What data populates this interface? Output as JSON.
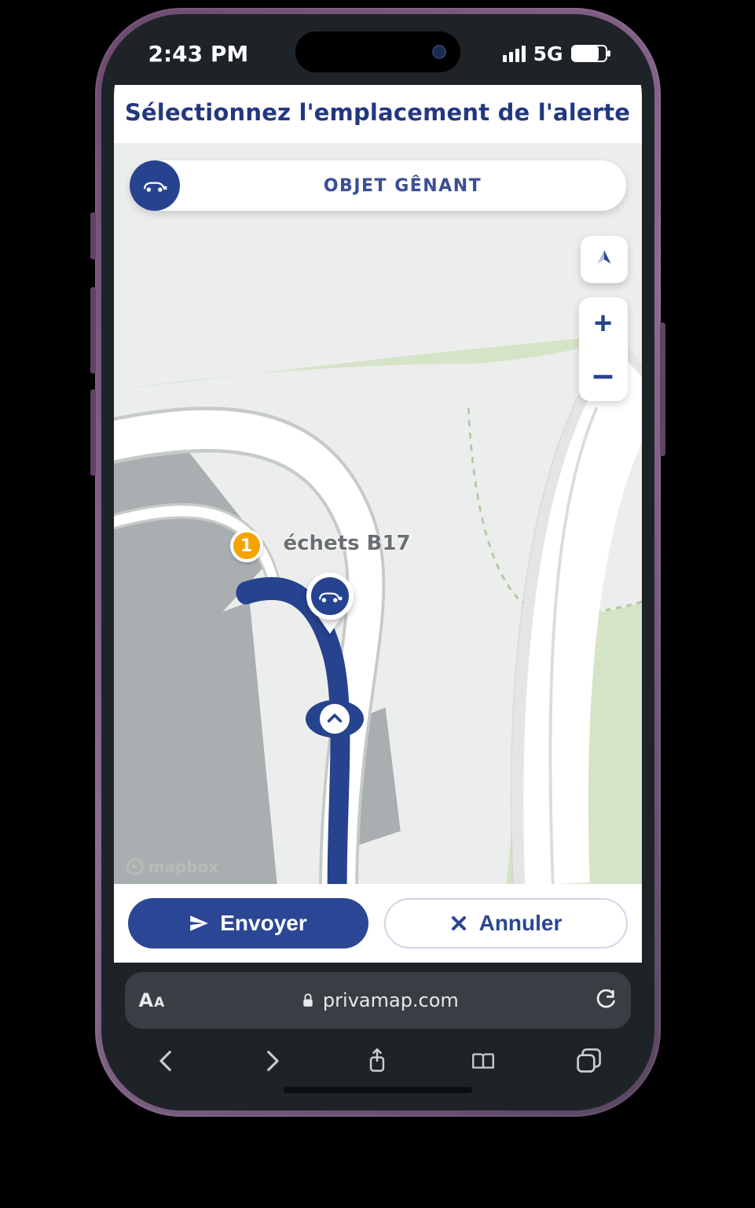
{
  "statusbar": {
    "time": "2:43 PM",
    "network": "5G"
  },
  "header": {
    "title": "Sélectionnez l'emplacement de l'alerte"
  },
  "alert": {
    "label": "OBJET GÊNANT",
    "icon": "car-blocked-icon"
  },
  "map": {
    "attribution": "mapbox",
    "waypoint": {
      "number": "1"
    },
    "poi_label": "échets B17",
    "controls": {
      "zoom_in": "+",
      "zoom_out": "–"
    }
  },
  "actions": {
    "submit": "Envoyer",
    "cancel": "Annuler"
  },
  "browser": {
    "domain": "privamap.com"
  }
}
